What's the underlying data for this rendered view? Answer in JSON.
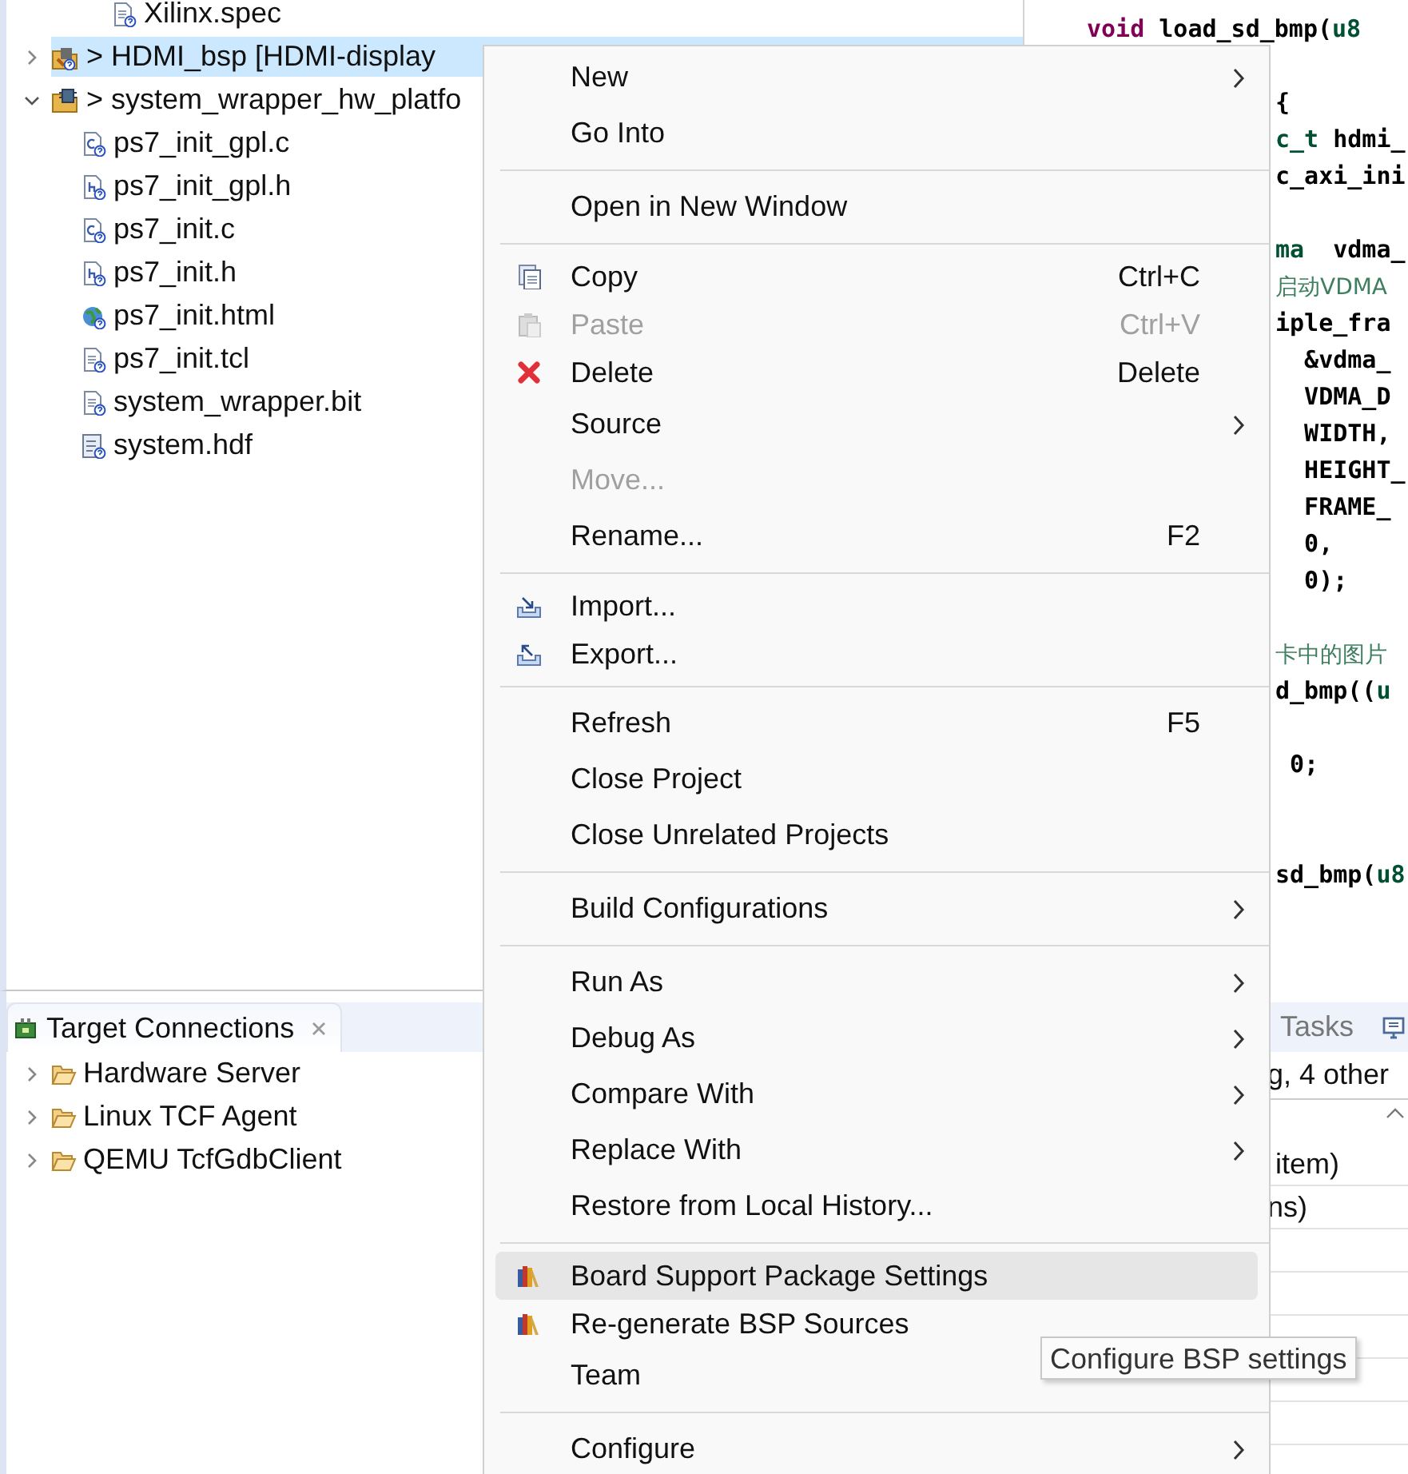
{
  "project_tree": {
    "continued_children": [
      {
        "label": "Xilinx.spec",
        "kind": "spec"
      }
    ],
    "items": [
      {
        "label": "> HDMI_bsp  [HDMI-display",
        "kind": "bsp_project",
        "expanded": false,
        "selected": true
      },
      {
        "label": "> system_wrapper_hw_platfo",
        "kind": "hw_project",
        "expanded": true,
        "selected": false,
        "children": [
          {
            "label": "ps7_init_gpl.c",
            "kind": "c",
            "selected": false
          },
          {
            "label": "ps7_init_gpl.h",
            "kind": "h",
            "selected": false
          },
          {
            "label": "ps7_init.c",
            "kind": "c",
            "selected": false
          },
          {
            "label": "ps7_init.h",
            "kind": "h",
            "selected": false
          },
          {
            "label": "ps7_init.html",
            "kind": "html",
            "selected": false
          },
          {
            "label": "ps7_init.tcl",
            "kind": "text",
            "selected": false
          },
          {
            "label": "system_wrapper.bit",
            "kind": "text",
            "selected": false
          },
          {
            "label": "system.hdf",
            "kind": "hdf",
            "selected": false
          }
        ]
      }
    ]
  },
  "editor": {
    "lines": [
      {
        "kind": "code",
        "clipped": false,
        "segments": [
          {
            "text": "void",
            "kind": "keyword"
          },
          {
            "text": " load_sd_bmp(",
            "kind": "plain"
          },
          {
            "text": "u8",
            "kind": "type"
          }
        ]
      },
      {
        "kind": "blank"
      },
      {
        "kind": "code",
        "clipped": true,
        "segments": [
          {
            "text": "{",
            "kind": "plain"
          }
        ]
      },
      {
        "kind": "code",
        "clipped": true,
        "segments": [
          {
            "text": "c_t",
            "kind": "type"
          },
          {
            "text": " hdmi_",
            "kind": "plain"
          }
        ]
      },
      {
        "kind": "code",
        "clipped": true,
        "segments": [
          {
            "text": "c_axi_ini",
            "kind": "plain"
          }
        ]
      },
      {
        "kind": "blank"
      },
      {
        "kind": "code",
        "clipped": true,
        "segments": [
          {
            "text": "ma",
            "kind": "type"
          },
          {
            "text": "  vdma_",
            "kind": "plain"
          }
        ]
      },
      {
        "kind": "code",
        "clipped": true,
        "segments": [
          {
            "text": "启动VDMA",
            "kind": "comment"
          }
        ]
      },
      {
        "kind": "code",
        "clipped": true,
        "segments": [
          {
            "text": "iple_fra",
            "kind": "plain"
          }
        ]
      },
      {
        "kind": "code",
        "clipped": true,
        "segments": [
          {
            "text": "  &vdma_",
            "kind": "plain"
          }
        ]
      },
      {
        "kind": "code",
        "clipped": true,
        "segments": [
          {
            "text": "  VDMA_D",
            "kind": "plain"
          }
        ]
      },
      {
        "kind": "code",
        "clipped": true,
        "segments": [
          {
            "text": "  WIDTH,",
            "kind": "plain"
          }
        ]
      },
      {
        "kind": "code",
        "clipped": true,
        "segments": [
          {
            "text": "  HEIGHT_",
            "kind": "plain"
          }
        ]
      },
      {
        "kind": "code",
        "clipped": true,
        "segments": [
          {
            "text": "  FRAME_",
            "kind": "plain"
          }
        ]
      },
      {
        "kind": "code",
        "clipped": true,
        "segments": [
          {
            "text": "  0,",
            "kind": "plain"
          }
        ]
      },
      {
        "kind": "code",
        "clipped": true,
        "segments": [
          {
            "text": "  0);",
            "kind": "plain"
          }
        ]
      },
      {
        "kind": "blank"
      },
      {
        "kind": "code",
        "clipped": true,
        "segments": [
          {
            "text": "卡中的图片",
            "kind": "comment"
          }
        ]
      },
      {
        "kind": "code",
        "clipped": true,
        "segments": [
          {
            "text": "d_bmp((",
            "kind": "plain"
          },
          {
            "text": "u",
            "kind": "type"
          }
        ]
      },
      {
        "kind": "blank"
      },
      {
        "kind": "code",
        "clipped": true,
        "segments": [
          {
            "text": " 0;",
            "kind": "plain"
          }
        ]
      },
      {
        "kind": "blank"
      },
      {
        "kind": "blank"
      },
      {
        "kind": "code",
        "clipped": true,
        "segments": [
          {
            "text": "sd_bmp(",
            "kind": "plain"
          },
          {
            "text": "u8",
            "kind": "type"
          }
        ]
      }
    ]
  },
  "target_connections": {
    "title": "Target Connections",
    "items": [
      {
        "label": "Hardware Server",
        "expanded": false
      },
      {
        "label": "Linux TCF Agent",
        "expanded": false
      },
      {
        "label": "QEMU TcfGdbClient",
        "expanded": false
      }
    ]
  },
  "tasks_view": {
    "tab": "Tasks",
    "summary": "g, 4 other",
    "rows": [
      {
        "text": " item)"
      },
      {
        "text": "ns)"
      }
    ]
  },
  "context_menu": {
    "items": [
      {
        "kind": "plain",
        "label": "New",
        "submenu": true,
        "disabled": false,
        "selected": false
      },
      {
        "kind": "plain",
        "label": "Go Into",
        "submenu": false,
        "disabled": false,
        "selected": false
      },
      {
        "kind": "separator"
      },
      {
        "kind": "plain",
        "label": "Open in New Window",
        "submenu": false,
        "disabled": false,
        "selected": false
      },
      {
        "kind": "separator"
      },
      {
        "kind": "copy",
        "label": "Copy",
        "shortcut": "Ctrl+C",
        "submenu": false,
        "disabled": false,
        "selected": false
      },
      {
        "kind": "paste",
        "label": "Paste",
        "shortcut": "Ctrl+V",
        "submenu": false,
        "disabled": true,
        "selected": false
      },
      {
        "kind": "delete",
        "label": "Delete",
        "shortcut": "Delete",
        "submenu": false,
        "disabled": false,
        "selected": false
      },
      {
        "kind": "plain",
        "label": "Source",
        "submenu": true,
        "disabled": false,
        "selected": false
      },
      {
        "kind": "plain",
        "label": "Move...",
        "submenu": false,
        "disabled": true,
        "selected": false
      },
      {
        "kind": "plain",
        "label": "Rename...",
        "shortcut": "F2",
        "submenu": false,
        "disabled": false,
        "selected": false
      },
      {
        "kind": "separator"
      },
      {
        "kind": "import",
        "label": "Import...",
        "submenu": false,
        "disabled": false,
        "selected": false
      },
      {
        "kind": "export",
        "label": "Export...",
        "submenu": false,
        "disabled": false,
        "selected": false
      },
      {
        "kind": "separator"
      },
      {
        "kind": "plain",
        "label": "Refresh",
        "shortcut": "F5",
        "submenu": false,
        "disabled": false,
        "selected": false
      },
      {
        "kind": "plain",
        "label": "Close Project",
        "submenu": false,
        "disabled": false,
        "selected": false
      },
      {
        "kind": "plain",
        "label": "Close Unrelated Projects",
        "submenu": false,
        "disabled": false,
        "selected": false
      },
      {
        "kind": "separator"
      },
      {
        "kind": "plain",
        "label": "Build Configurations",
        "submenu": true,
        "disabled": false,
        "selected": false
      },
      {
        "kind": "separator"
      },
      {
        "kind": "plain",
        "label": "Run As",
        "submenu": true,
        "disabled": false,
        "selected": false
      },
      {
        "kind": "plain",
        "label": "Debug As",
        "submenu": true,
        "disabled": false,
        "selected": false
      },
      {
        "kind": "plain",
        "label": "Compare With",
        "submenu": true,
        "disabled": false,
        "selected": false
      },
      {
        "kind": "plain",
        "label": "Replace With",
        "submenu": true,
        "disabled": false,
        "selected": false
      },
      {
        "kind": "plain",
        "label": "Restore from Local History...",
        "submenu": false,
        "disabled": false,
        "selected": false
      },
      {
        "kind": "separator"
      },
      {
        "kind": "bsp",
        "label": "Board Support Package Settings",
        "submenu": false,
        "disabled": false,
        "selected": true
      },
      {
        "kind": "bsp",
        "label": "Re-generate BSP Sources",
        "submenu": false,
        "disabled": false,
        "selected": false
      },
      {
        "kind": "plain",
        "label": "Team",
        "submenu": false,
        "disabled": false,
        "selected": false
      },
      {
        "kind": "separator"
      },
      {
        "kind": "plain",
        "label": "Configure",
        "submenu": true,
        "disabled": false,
        "selected": false
      }
    ]
  },
  "tooltip": {
    "text": "Configure BSP settings"
  }
}
